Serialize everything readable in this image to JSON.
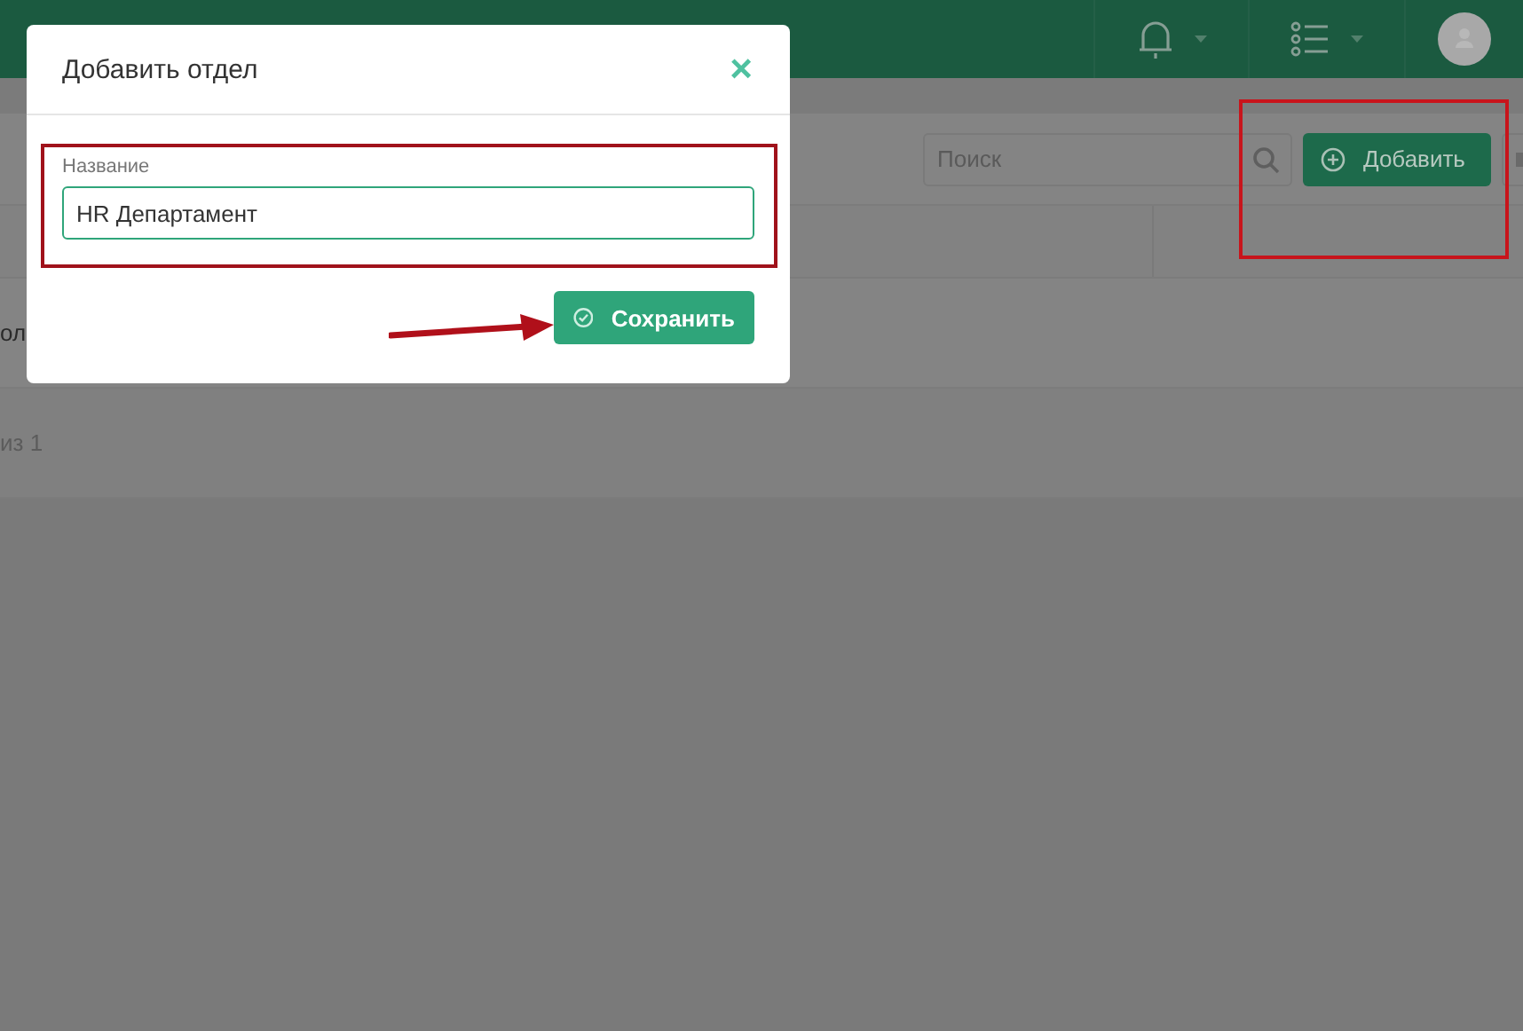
{
  "toolbar": {
    "search": {
      "placeholder": "Поиск"
    },
    "add_button": "Добавить"
  },
  "table": {
    "rows": [
      {
        "cell_1": "ол"
      },
      {
        "cell_1": "из 1"
      }
    ]
  },
  "modal": {
    "title": "Добавить отдел",
    "close": "×",
    "field": {
      "label": "Название",
      "value": "HR Департамент"
    },
    "save_button": "Сохранить"
  },
  "annotations": [
    {
      "kind": "box"
    },
    {
      "kind": "box"
    },
    {
      "kind": "arrow"
    }
  ]
}
